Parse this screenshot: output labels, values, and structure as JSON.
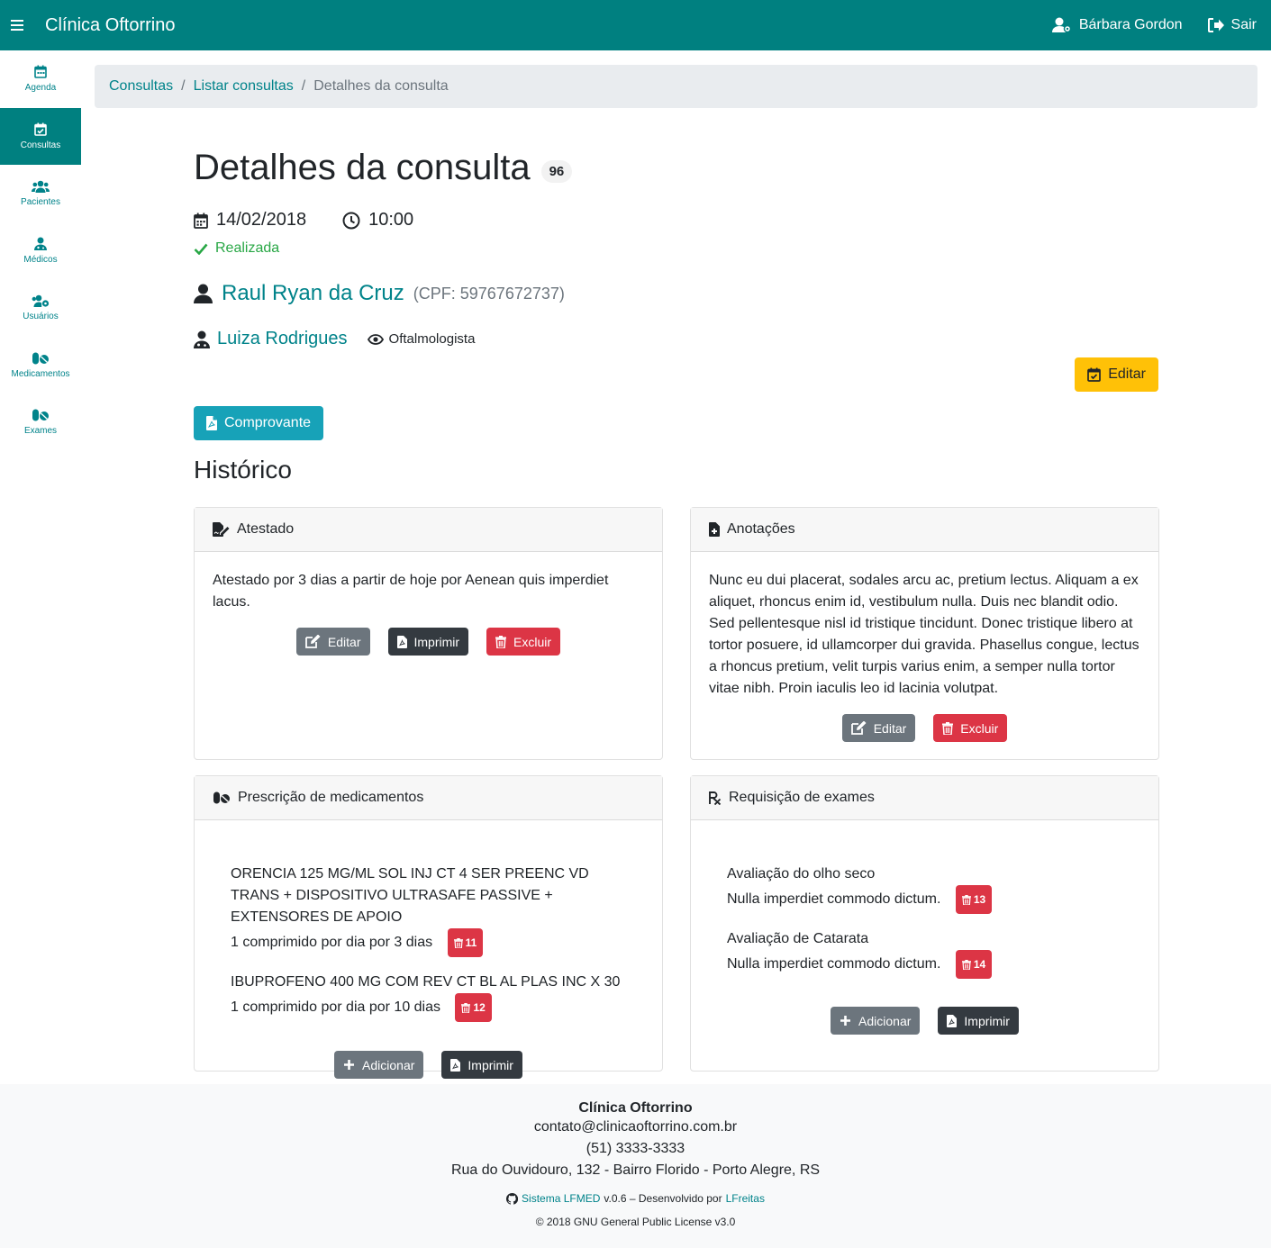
{
  "app": {
    "brand": "Clínica Oftorrino",
    "user": "Bárbara Gordon",
    "logout": "Sair"
  },
  "sidebar": {
    "items": [
      {
        "label": "Agenda",
        "icon": "calendar-icon"
      },
      {
        "label": "Consultas",
        "icon": "calendar-check-icon",
        "active": true
      },
      {
        "label": "Pacientes",
        "icon": "users-icon"
      },
      {
        "label": "Médicos",
        "icon": "user-md-icon"
      },
      {
        "label": "Usuários",
        "icon": "users-cog-icon"
      },
      {
        "label": "Medicamentos",
        "icon": "pills-icon"
      },
      {
        "label": "Exames",
        "icon": "pills-icon"
      }
    ]
  },
  "breadcrumb": {
    "item1": "Consultas",
    "item2": "Listar consultas",
    "current": "Detalhes da consulta"
  },
  "consulta": {
    "title": "Detalhes da consulta",
    "id": "96",
    "date": "14/02/2018",
    "time": "10:00",
    "status": "Realizada",
    "patient_name": "Raul Ryan da Cruz",
    "patient_cpf": "(CPF: 59767672737)",
    "doctor_name": "Luiza Rodrigues",
    "specialty": "Oftalmologista",
    "edit_label": "Editar",
    "comprovante_label": "Comprovante",
    "historico_label": "Histórico"
  },
  "atestado": {
    "header": "Atestado",
    "text": "Atestado por 3 dias a partir de hoje por Aenean quis imperdiet lacus.",
    "btn_edit": "Editar",
    "btn_print": "Imprimir",
    "btn_delete": "Excluir"
  },
  "anotacoes": {
    "header": "Anotações",
    "text": "Nunc eu dui placerat, sodales arcu ac, pretium lectus. Aliquam a ex aliquet, rhoncus enim id, vestibulum nulla. Duis nec blandit odio. Sed pellentesque nisl id tristique tincidunt. Donec tristique libero at tortor posuere, id ullamcorper dui gravida. Phasellus congue, lectus a rhoncus pretium, velit turpis varius enim, a semper nulla tortor vitae nibh. Proin iaculis leo id lacinia volutpat.",
    "btn_edit": "Editar",
    "btn_delete": "Excluir"
  },
  "prescricao": {
    "header": "Prescrição de medicamentos",
    "items": [
      {
        "name": "ORENCIA 125 MG/ML SOL INJ CT 4 SER PREENC VD TRANS + DISPOSITIVO ULTRASAFE PASSIVE + EXTENSORES DE APOIO",
        "dose": "1 comprimido por dia por 3 dias",
        "id": "11"
      },
      {
        "name": "IBUPROFENO 400 MG COM REV CT BL AL PLAS INC X 30",
        "dose": "1 comprimido por dia por 10 dias",
        "id": "12"
      }
    ],
    "btn_add": "Adicionar",
    "btn_print": "Imprimir"
  },
  "exames": {
    "header": "Requisição de exames",
    "items": [
      {
        "name": "Avaliação do olho seco",
        "note": "Nulla imperdiet commodo dictum.",
        "id": "13"
      },
      {
        "name": "Avaliação de Catarata",
        "note": "Nulla imperdiet commodo dictum.",
        "id": "14"
      }
    ],
    "btn_add": "Adicionar",
    "btn_print": "Imprimir"
  },
  "footer": {
    "brand": "Clínica Oftorrino",
    "email": "contato@clinicaoftorrino.com.br",
    "phone": "(51) 3333-3333",
    "address": "Rua do Ouvidouro, 132 - Bairro Florido - Porto Alegre, RS",
    "system_link": "Sistema LFMED",
    "version_text": "v.0.6 – Desenvolvido por",
    "author_link": "LFreitas",
    "license": "© 2018 GNU General Public License v3.0"
  }
}
